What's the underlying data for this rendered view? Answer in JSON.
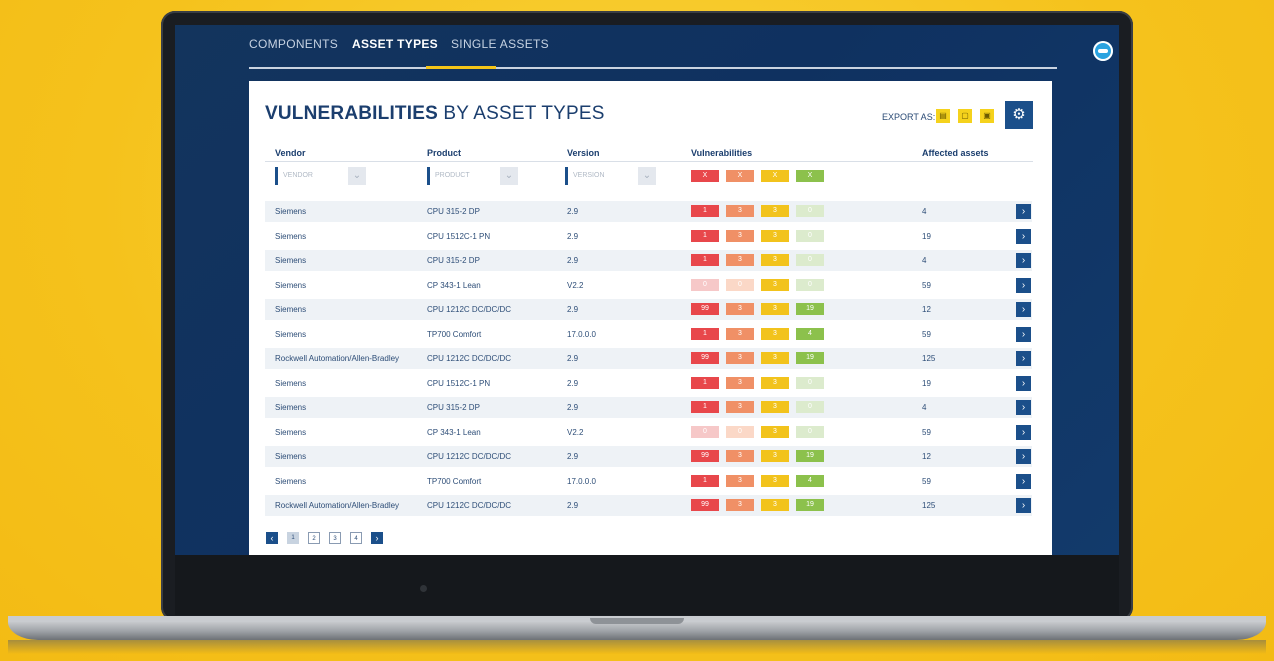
{
  "tabs": [
    "COMPONENTS",
    "ASSET TYPES",
    "SINGLE ASSETS"
  ],
  "title_bold": "VULNERABILITIES",
  "title_rest": " BY ASSET TYPES",
  "export_label": "EXPORT AS:",
  "columns": {
    "vendor": "Vendor",
    "product": "Product",
    "version": "Version",
    "vulnerabilities": "Vulnerabilities",
    "affected": "Affected assets"
  },
  "filters": {
    "vendor": "VENDOR",
    "product": "PRODUCT",
    "version": "VERSION",
    "chip": "X"
  },
  "severity_colors": {
    "critical": "#e8474b",
    "high": "#f09066",
    "medium": "#f2c31c",
    "low": "#8cc14c",
    "critical_zero": "#f6c8c8",
    "high_zero": "#fbd8c7",
    "low_zero": "#dcebcd"
  },
  "rows": [
    {
      "vendor": "Siemens",
      "product": "CPU 315-2 DP",
      "version": "2.9",
      "v": [
        "1",
        "3",
        "3",
        "0"
      ],
      "affected": "4"
    },
    {
      "vendor": "Siemens",
      "product": "CPU 1512C-1 PN",
      "version": "2.9",
      "v": [
        "1",
        "3",
        "3",
        "0"
      ],
      "affected": "19"
    },
    {
      "vendor": "Siemens",
      "product": "CPU 315-2 DP",
      "version": "2.9",
      "v": [
        "1",
        "3",
        "3",
        "0"
      ],
      "affected": "4"
    },
    {
      "vendor": "Siemens",
      "product": "CP 343-1 Lean",
      "version": "V2.2",
      "v": [
        "0",
        "0",
        "3",
        "0"
      ],
      "affected": "59"
    },
    {
      "vendor": "Siemens",
      "product": "CPU 1212C DC/DC/DC",
      "version": "2.9",
      "v": [
        "99",
        "3",
        "3",
        "19"
      ],
      "affected": "12"
    },
    {
      "vendor": "Siemens",
      "product": "TP700 Comfort",
      "version": "17.0.0.0",
      "v": [
        "1",
        "3",
        "3",
        "4"
      ],
      "affected": "59"
    },
    {
      "vendor": "Rockwell Automation/Allen-Bradley",
      "product": "CPU 1212C DC/DC/DC",
      "version": "2.9",
      "v": [
        "99",
        "3",
        "3",
        "19"
      ],
      "affected": "125"
    },
    {
      "vendor": "Siemens",
      "product": "CPU 1512C-1 PN",
      "version": "2.9",
      "v": [
        "1",
        "3",
        "3",
        "0"
      ],
      "affected": "19"
    },
    {
      "vendor": "Siemens",
      "product": "CPU 315-2 DP",
      "version": "2.9",
      "v": [
        "1",
        "3",
        "3",
        "0"
      ],
      "affected": "4"
    },
    {
      "vendor": "Siemens",
      "product": "CP 343-1 Lean",
      "version": "V2.2",
      "v": [
        "0",
        "0",
        "3",
        "0"
      ],
      "affected": "59"
    },
    {
      "vendor": "Siemens",
      "product": "CPU 1212C DC/DC/DC",
      "version": "2.9",
      "v": [
        "99",
        "3",
        "3",
        "19"
      ],
      "affected": "12"
    },
    {
      "vendor": "Siemens",
      "product": "TP700 Comfort",
      "version": "17.0.0.0",
      "v": [
        "1",
        "3",
        "3",
        "4"
      ],
      "affected": "59"
    },
    {
      "vendor": "Rockwell Automation/Allen-Bradley",
      "product": "CPU 1212C DC/DC/DC",
      "version": "2.9",
      "v": [
        "99",
        "3",
        "3",
        "19"
      ],
      "affected": "125"
    }
  ],
  "pagination": {
    "pages": [
      "1",
      "2",
      "3",
      "4"
    ],
    "current": "1",
    "prev_icon": "chevron-left-icon",
    "next_icon": "chevron-right-icon"
  }
}
